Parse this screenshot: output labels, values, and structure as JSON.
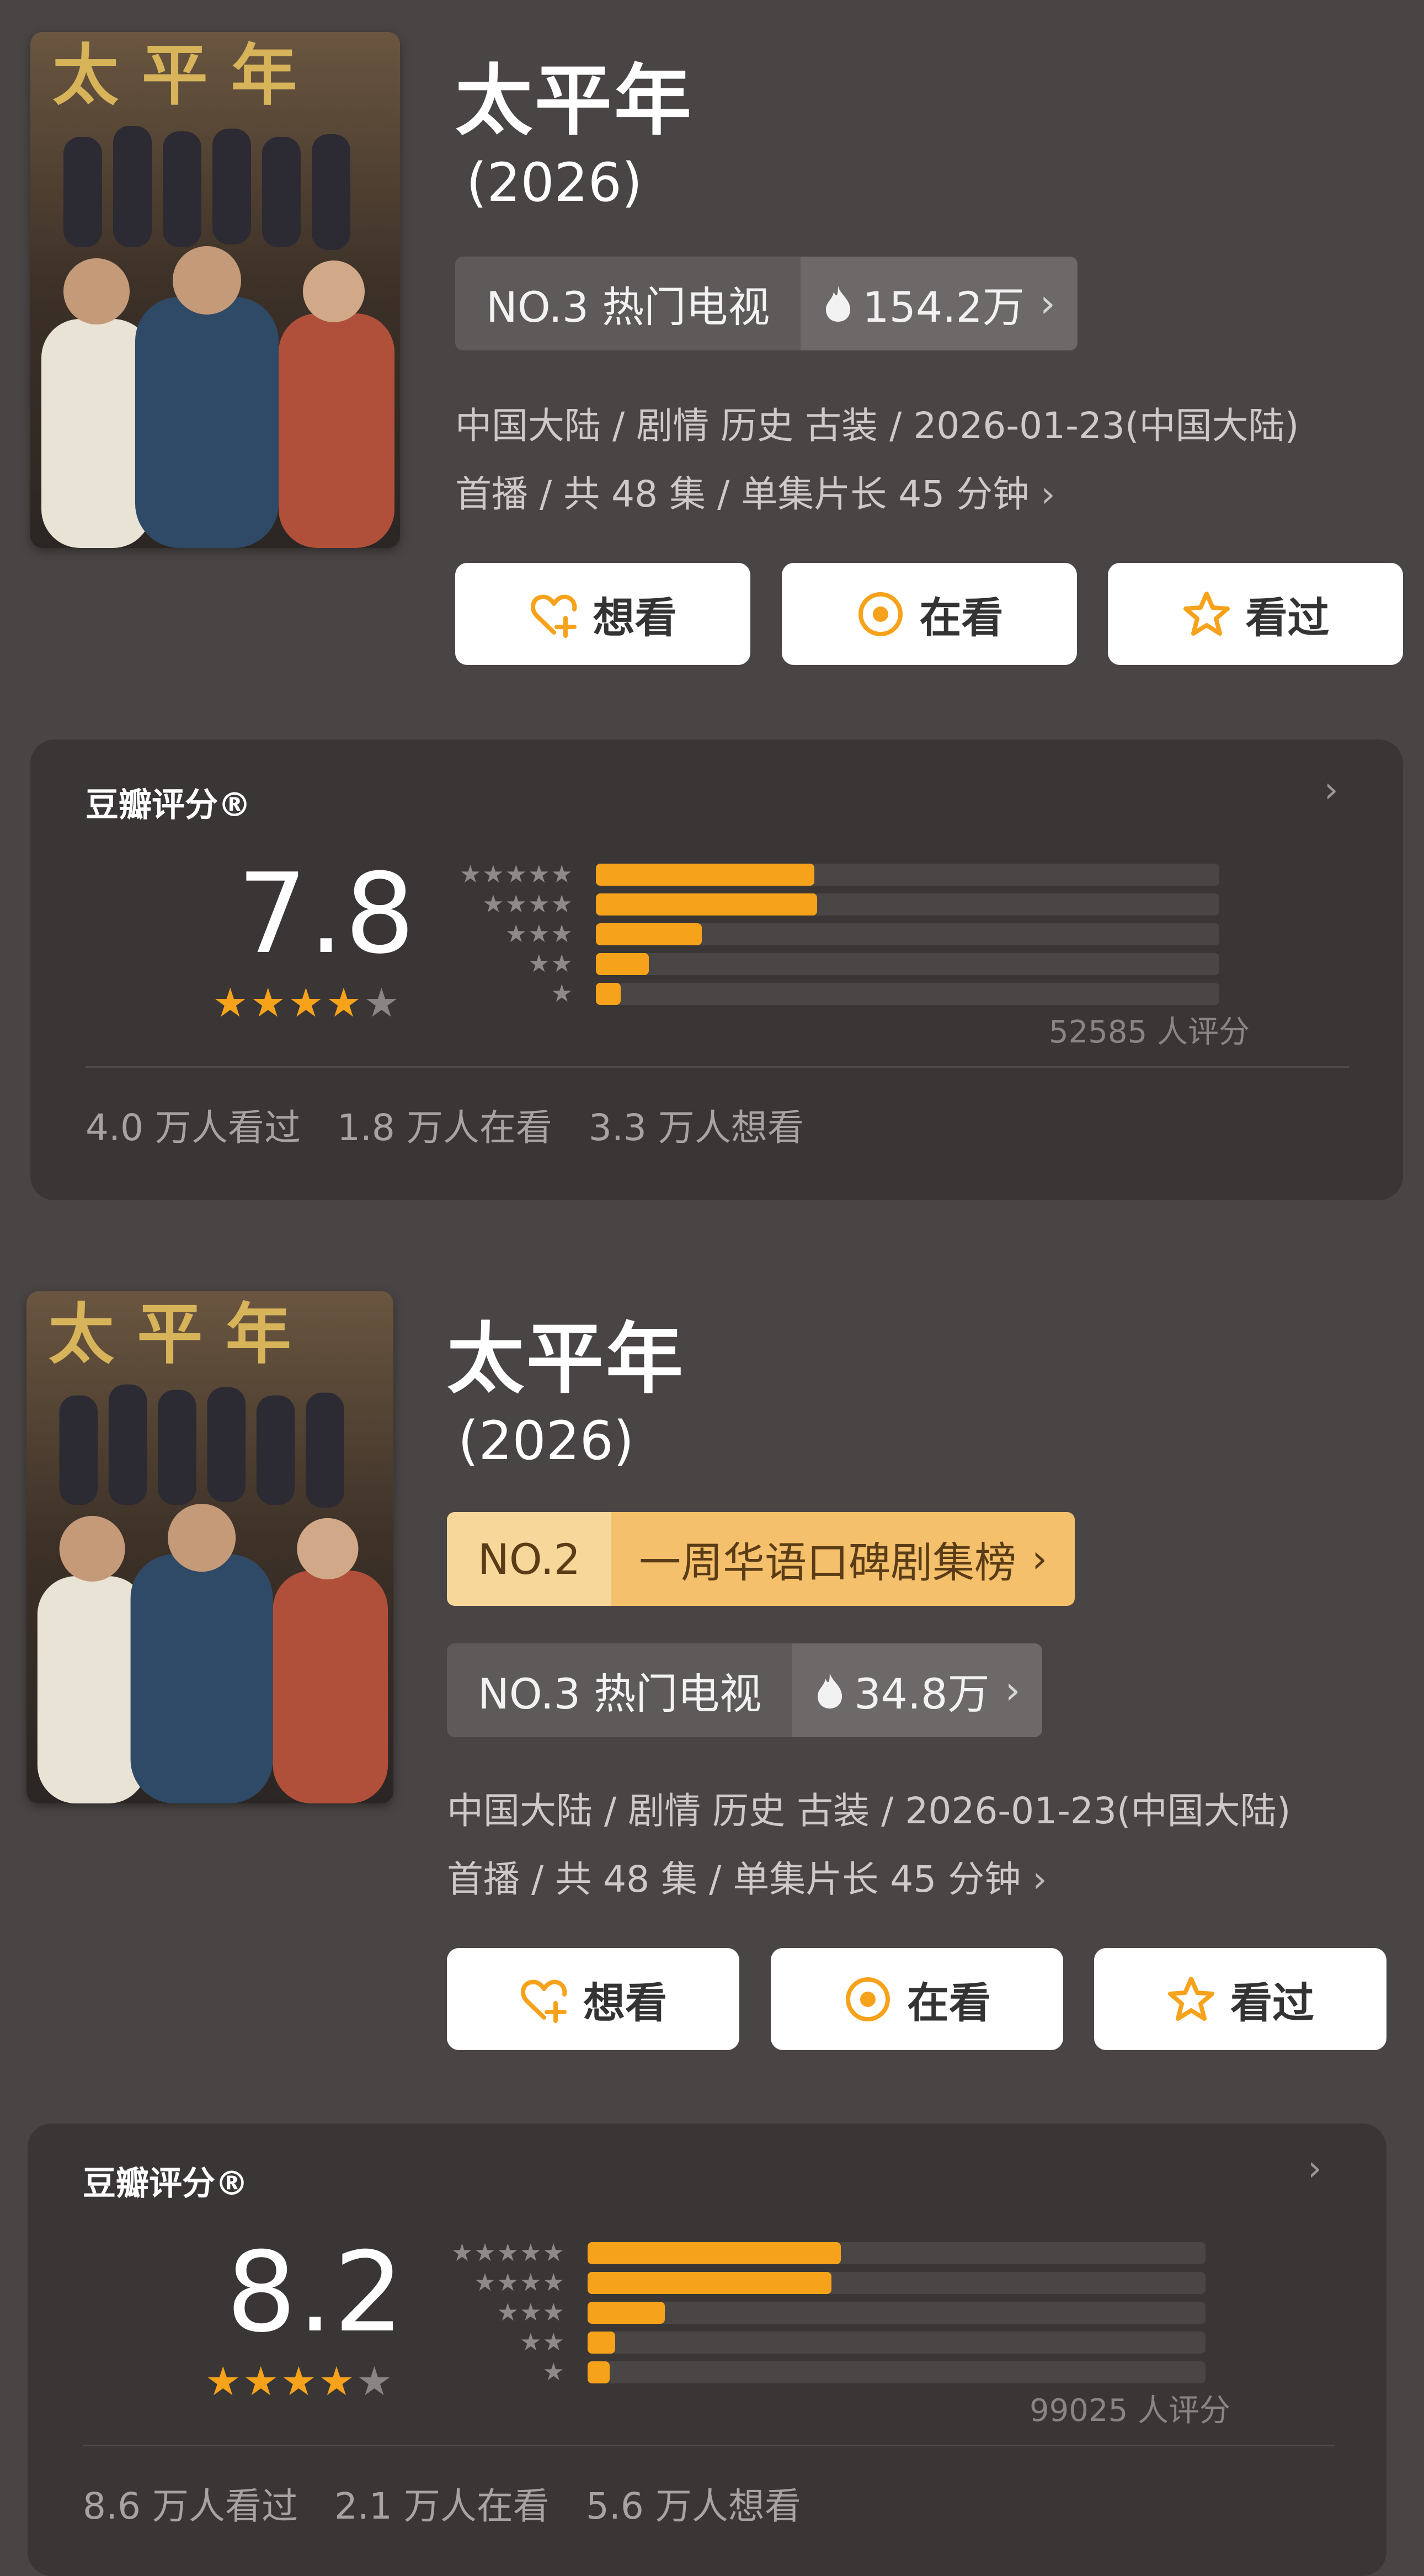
{
  "entries": [
    {
      "title": "太平年",
      "year": "(2026)",
      "rank_list": null,
      "hot": {
        "label": "NO.3 热门电视",
        "count": "154.2万"
      },
      "meta_line1": "中国大陆 / 剧情 历史 古装 / 2026-01-23(中国大陆)",
      "meta_line2": "首播 / 共 48 集 / 单集片长 45 分钟",
      "buttons": [
        "想看",
        "在看",
        "看过"
      ],
      "rating": {
        "label": "豆瓣评分®",
        "score": "7.8",
        "stars": 4,
        "distribution": [
          {
            "stars": "★★★★★",
            "fraction": 0.35
          },
          {
            "stars": "★★★★",
            "fraction": 0.355
          },
          {
            "stars": "★★★",
            "fraction": 0.17
          },
          {
            "stars": "★★",
            "fraction": 0.085
          },
          {
            "stars": "★",
            "fraction": 0.04
          }
        ],
        "votes": "52585 人评分",
        "counts": [
          "4.0 万人看过",
          "1.8 万人在看",
          "3.3 万人想看"
        ]
      }
    },
    {
      "title": "太平年",
      "year": "(2026)",
      "rank_list": {
        "rank": "NO.2",
        "name": "一周华语口碑剧集榜"
      },
      "hot": {
        "label": "NO.3 热门电视",
        "count": "34.8万"
      },
      "meta_line1": "中国大陆 / 剧情 历史 古装 / 2026-01-23(中国大陆)",
      "meta_line2": "首播 / 共 48 集 / 单集片长 45 分钟",
      "buttons": [
        "想看",
        "在看",
        "看过"
      ],
      "rating": {
        "label": "豆瓣评分®",
        "score": "8.2",
        "stars": 4,
        "distribution": [
          {
            "stars": "★★★★★",
            "fraction": 0.41
          },
          {
            "stars": "★★★★",
            "fraction": 0.395
          },
          {
            "stars": "★★★",
            "fraction": 0.125
          },
          {
            "stars": "★★",
            "fraction": 0.045
          },
          {
            "stars": "★",
            "fraction": 0.035
          }
        ],
        "votes": "99025 人评分",
        "counts": [
          "8.6 万人看过",
          "2.1 万人在看",
          "5.6 万人想看"
        ]
      }
    }
  ],
  "colors": {
    "accent": "#f7a21b",
    "background": "#4a4545",
    "card": "#3a3636"
  },
  "icons": {
    "want": "heart-plus-icon",
    "watching": "target-icon",
    "watched": "star-outline-icon",
    "hot": "flame-icon"
  }
}
